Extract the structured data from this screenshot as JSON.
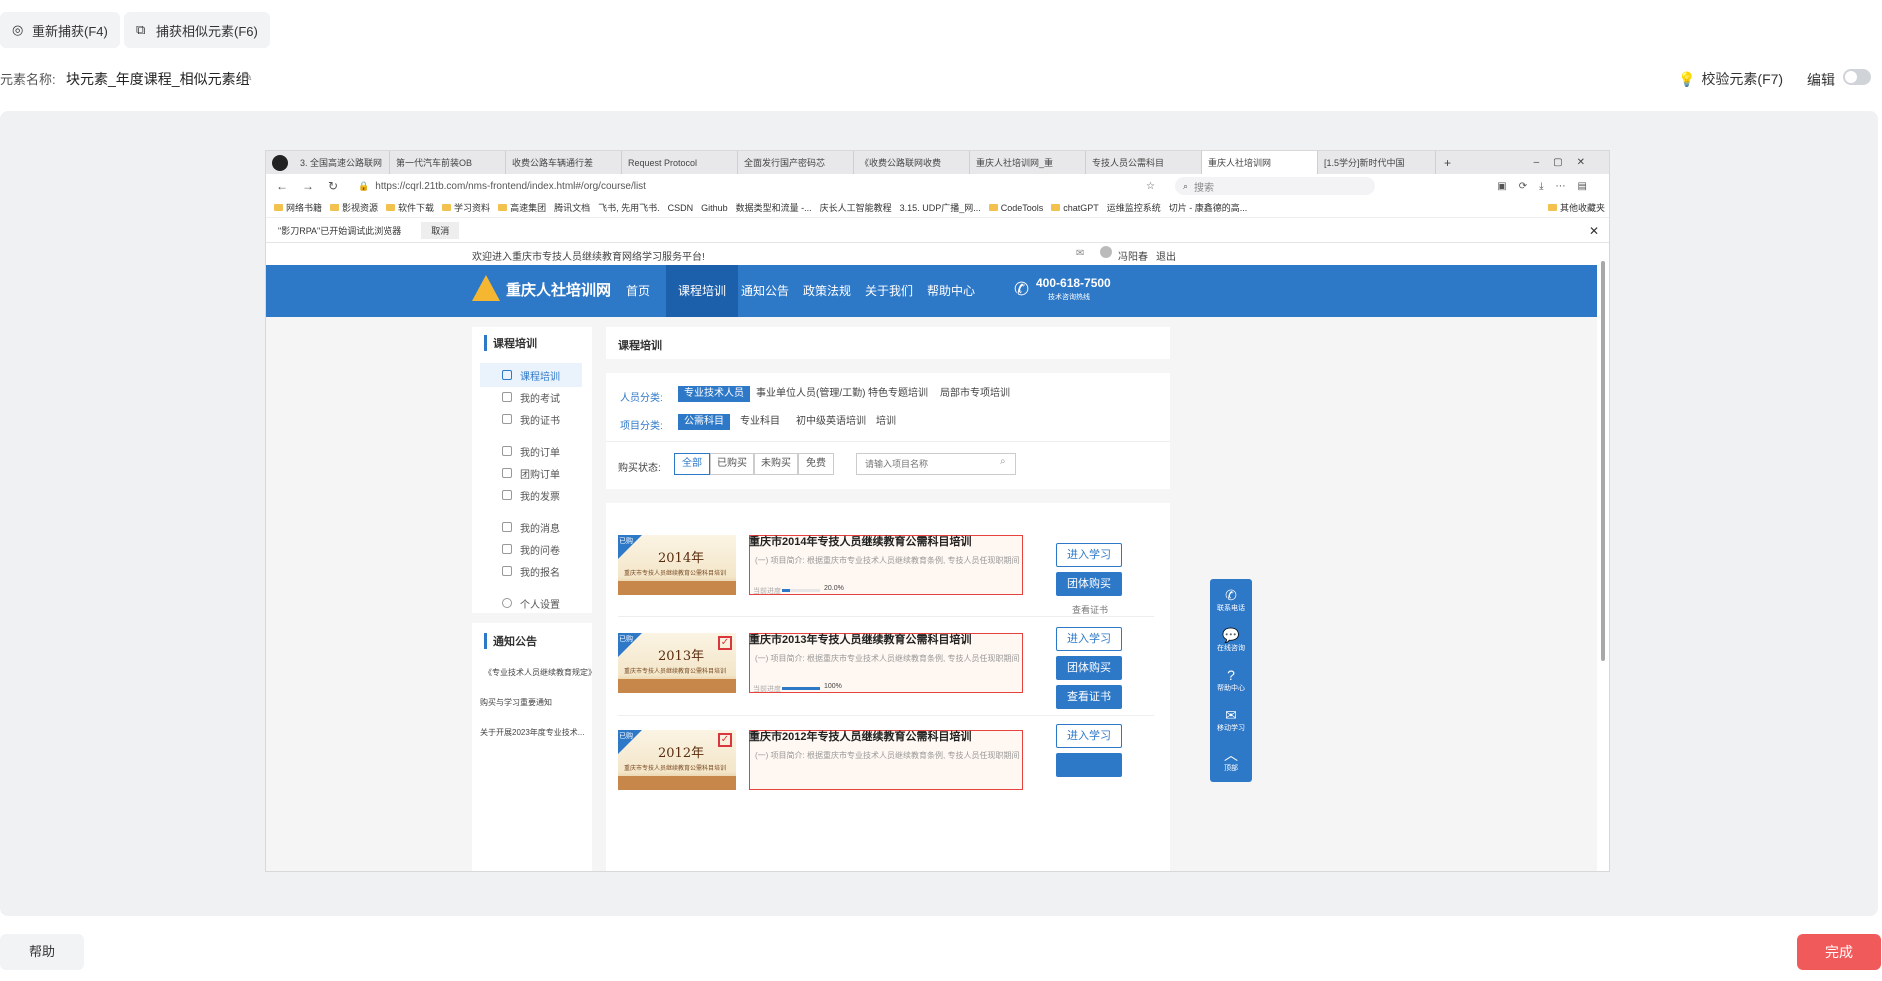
{
  "toolbar": {
    "recapture_label": "重新捕获(F4)",
    "capture_similar_label": "捕获相似元素(F6)",
    "element_name_label": "元素名称:",
    "element_name_value": "块元素_年度课程_相似元素组",
    "verify_label": "校验元素(F7)",
    "edit_label": "编辑",
    "edit_enabled": false
  },
  "browser": {
    "tabs": [
      {
        "title": "3. 全国高速公路联网"
      },
      {
        "title": "第一代汽车前装OB"
      },
      {
        "title": "收费公路车辆通行差"
      },
      {
        "title": "Request Protocol"
      },
      {
        "title": "全面发行国产密码芯"
      },
      {
        "title": "《收费公路联网收费"
      },
      {
        "title": "重庆人社培训网_重"
      },
      {
        "title": "专技人员公需科目"
      },
      {
        "title": "重庆人社培训网",
        "active": true
      },
      {
        "title": "[1.5学分]新时代中国"
      }
    ],
    "url": "https://cqrl.21tb.com/nms-frontend/index.html#/org/course/list",
    "search_placeholder": "搜索",
    "bookmarks": [
      "网络书籍",
      "影视资源",
      "软件下载",
      "学习资料",
      "高速集团",
      "腾讯文档",
      "飞书, 先用飞书.",
      "CSDN",
      "Github",
      "数据类型和流量 -...",
      "庆长人工智能教程",
      "3.15. UDP广播_网...",
      "CodeTools",
      "chatGPT",
      "运维监控系统",
      "切片 - 康鑫德的高...",
      "其他收藏夹"
    ],
    "rpa_notice": "\"影刀RPA\"已开始调试此浏览器",
    "rpa_cancel": "取消"
  },
  "site": {
    "welcome": "欢迎进入重庆市专技人员继续教育网络学习服务平台!",
    "username": "冯阳春",
    "logout": "退出",
    "logo": "重庆人社培训网",
    "nav": [
      "首页",
      "课程培训",
      "通知公告",
      "政策法规",
      "关于我们",
      "帮助中心"
    ],
    "active_nav": "课程培训",
    "hotline": "400-618-7500",
    "hotline_sub": "技术咨询热线",
    "sidebar_title": "课程培训",
    "sidebar_items": [
      "课程培训",
      "我的考试",
      "我的证书",
      "我的订单",
      "团购订单",
      "我的发票",
      "我的消息",
      "我的问卷",
      "我的报名",
      "个人设置"
    ],
    "notice_title": "通知公告",
    "notices": [
      "《专业技术人员继续教育规定》",
      "购买与学习重要通知",
      "关于开展2023年度专业技术..."
    ],
    "panel_title": "课程培训",
    "person_label": "人员分类:",
    "person_tags": [
      "专业技术人员",
      "事业单位人员(管理/工勤)",
      "特色专题培训",
      "局部市专项培训"
    ],
    "project_label": "项目分类:",
    "project_tags": [
      "公需科目",
      "专业科目",
      "初中级英语培训",
      "培训"
    ],
    "buy_label": "购买状态:",
    "buy_tags": [
      "全部",
      "已购买",
      "未购买",
      "免费"
    ],
    "search_placeholder": "请输入项目名称",
    "courses": [
      {
        "badge": "已购",
        "year": "2014年",
        "sub": "重庆市专技人员继续教育公需科目培训",
        "title": "重庆市2014年专技人员继续教育公需科目培训",
        "desc": "(一) 项目简介: 根据重庆市专业技术人员继续教育条例, 专技人员任现职期间每年...",
        "progress_label": "当前进度",
        "progress": 20.0,
        "progress_text": "20.0%",
        "btn_study": "进入学习",
        "btn_group": "团体购买",
        "cert": "查看证书"
      },
      {
        "badge": "已购",
        "year": "2013年",
        "sub": "重庆市专技人员继续教育公需科目培训",
        "title": "重庆市2013年专技人员继续教育公需科目培训",
        "desc": "(一) 项目简介: 根据重庆市专业技术人员继续教育条例, 专技人员任现职期间每年...",
        "progress_label": "当前进度",
        "progress": 100,
        "progress_text": "100%",
        "btn_study": "进入学习",
        "btn_group": "团体购买",
        "cert": "查看证书"
      },
      {
        "badge": "已购",
        "year": "2012年",
        "sub": "重庆市专技人员继续教育公需科目培训",
        "title": "重庆市2012年专技人员继续教育公需科目培训",
        "desc": "(一) 项目简介: 根据重庆市专业技术人员继续教育条例, 专技人员任现职期间每年...",
        "btn_study": "进入学习"
      }
    ],
    "float_items": [
      "联系电话",
      "在线咨询",
      "帮助中心",
      "移动学习",
      "顶部"
    ]
  },
  "footer": {
    "help_label": "帮助",
    "done_label": "完成"
  },
  "colors": {
    "accent": "#2e78c8",
    "done": "#f15a5a",
    "highlight": "#e8423e"
  }
}
